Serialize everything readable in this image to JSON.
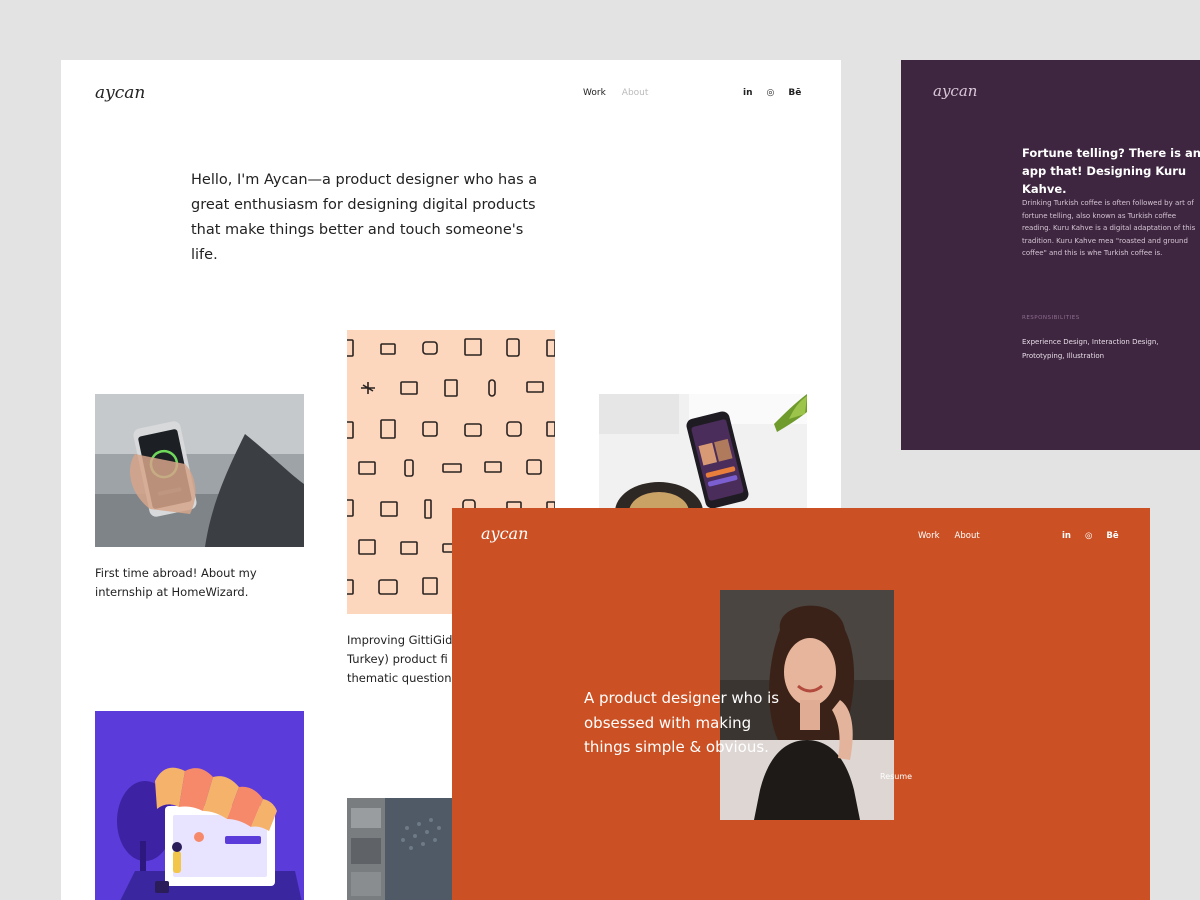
{
  "white_page": {
    "logo": "aycan",
    "nav": [
      "Work",
      "About"
    ],
    "social": [
      "in",
      "◎",
      "Bē"
    ],
    "intro": "Hello, I'm Aycan—a product designer who has a great enthusiasm for designing digital products that make things better and touch someone's life.",
    "projects": [
      {
        "caption": "First time abroad! About my internship at HomeWizard.",
        "image": "hand-holding-phone"
      },
      {
        "caption": "Improving GittiGid Turkey) product fi thematic question",
        "image": "icon-pattern"
      },
      {
        "caption": "",
        "image": "phone-on-desk"
      },
      {
        "caption": "",
        "image": "shop-illustration"
      },
      {
        "caption": "",
        "image": "dark-blue-tile"
      }
    ]
  },
  "purple_panel": {
    "logo": "aycan",
    "title": "Fortune telling? There is an app that! Designing Kuru Kahve.",
    "body": "Drinking Turkish coffee is often followed by art of fortune telling, also known as Turkish coffee reading. Kuru Kahve is a digital adaptation of this tradition. Kuru Kahve mea \"roasted and ground coffee\" and this is whe Turkish coffee is.",
    "responsibilities_label": "RESPONSIBILITIES",
    "responsibilities": "Experience Design, Interaction Design, Prototyping, Illustration"
  },
  "orange_panel": {
    "logo": "aycan",
    "nav": [
      "Work",
      "About"
    ],
    "social": [
      "in",
      "◎",
      "Bē"
    ],
    "tagline": "A product designer who is obsessed with making things simple & obvious.",
    "resume_label": "Resume"
  },
  "colors": {
    "background": "#e3e3e3",
    "purple": "#3e2540",
    "orange": "#cb5124",
    "peach": "#fcd7bd",
    "violet": "#5b3bd9"
  }
}
